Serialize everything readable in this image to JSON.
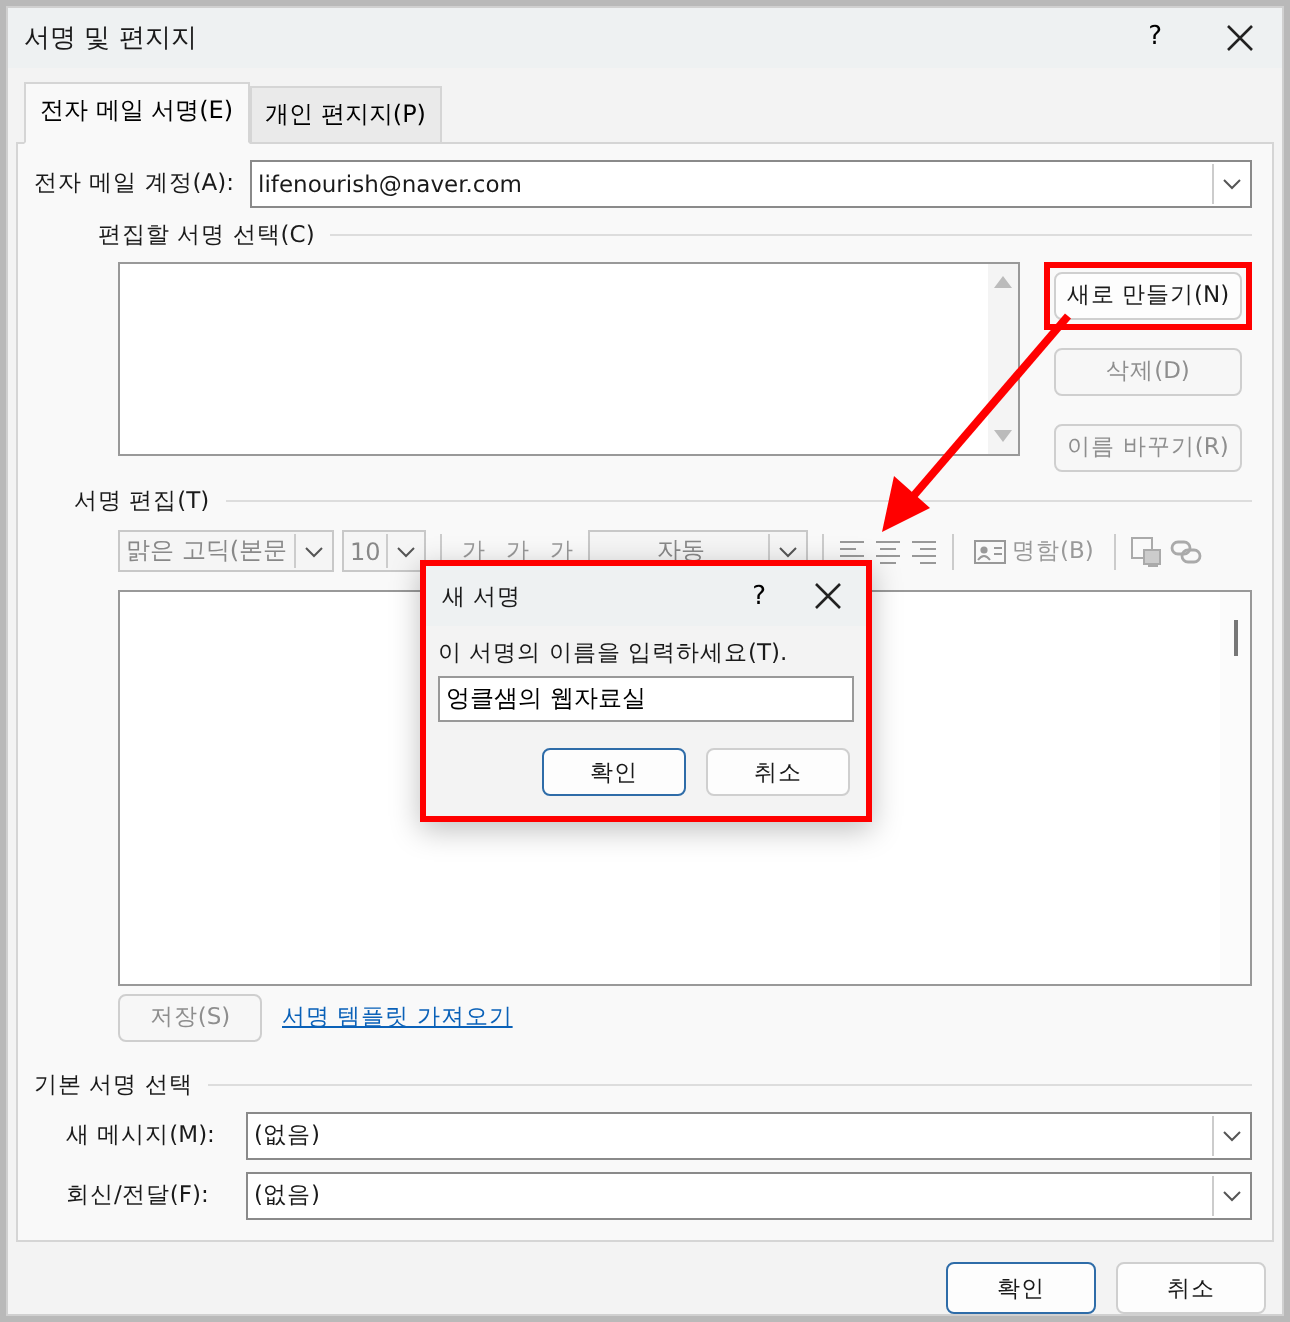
{
  "window": {
    "title": "서명 및 편지지",
    "help": "?"
  },
  "tabs": [
    {
      "label": "전자 메일 서명(E)",
      "selected": true
    },
    {
      "label": "개인 편지지(P)",
      "selected": false
    }
  ],
  "account": {
    "label": "전자 메일 계정(A):",
    "value": "lifenourish@naver.com"
  },
  "select_section": {
    "heading": "편집할 서명 선택(C)",
    "buttons": [
      {
        "label": "새로 만들기(N)",
        "disabled": false,
        "highlighted": true
      },
      {
        "label": "삭제(D)",
        "disabled": true,
        "highlighted": false
      },
      {
        "label": "이름 바꾸기(R)",
        "disabled": true,
        "highlighted": false
      }
    ]
  },
  "edit_section": {
    "heading": "서명 편집(T)",
    "toolbar": {
      "font": "맑은 고딕(본문",
      "size": "10",
      "styles": [
        "가",
        "가",
        "가"
      ],
      "color_label": "자동",
      "business_card": "명함(B)"
    },
    "save_button": {
      "label": "저장(S)",
      "disabled": true
    },
    "template_link": "서명 템플릿 가져오기"
  },
  "defaults_section": {
    "heading": "기본 서명 선택",
    "fields": [
      {
        "label": "새 메시지(M):",
        "value": "(없음)"
      },
      {
        "label": "회신/전달(F):",
        "value": "(없음)"
      }
    ]
  },
  "buttons": [
    {
      "label": "확인",
      "primary": true
    },
    {
      "label": "취소",
      "primary": false
    }
  ],
  "dialog": {
    "title": "새 서명",
    "help": "?",
    "prompt": "이 서명의 이름을 입력하세요(T).",
    "value": "엉클샘의 웹자료실",
    "highlighted": true,
    "buttons": [
      {
        "label": "확인",
        "primary": true
      },
      {
        "label": "취소",
        "primary": false
      }
    ]
  }
}
